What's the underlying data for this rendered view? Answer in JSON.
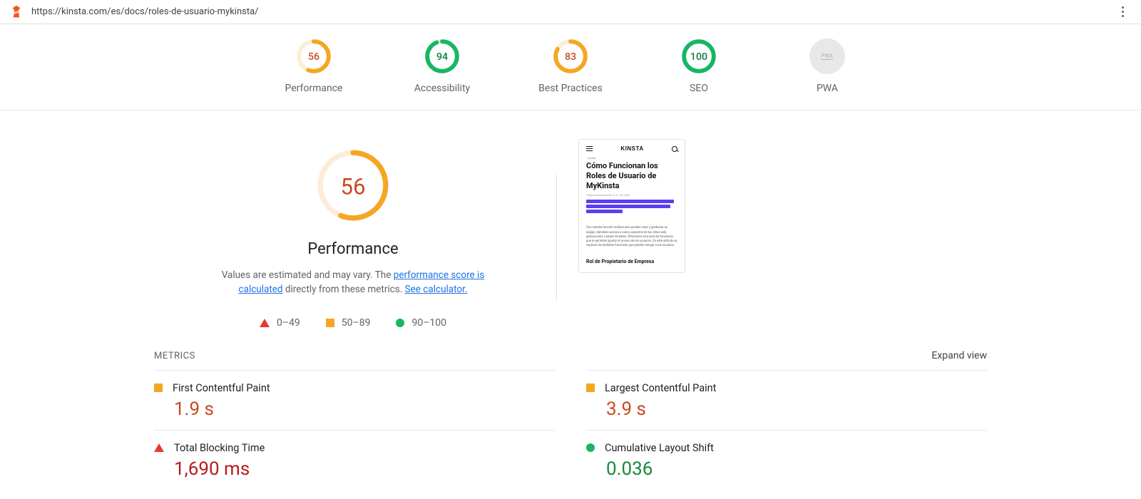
{
  "topbar": {
    "url": "https://kinsta.com/es/docs/roles-de-usuario-mykinsta/"
  },
  "colors": {
    "red": "#e53935",
    "orange": "#f5a623",
    "green": "#18b663",
    "grey": "#bdbdbd",
    "orangeText": "#c74a22",
    "greenText": "#0c7b3e"
  },
  "gauges": [
    {
      "label": "Performance",
      "score": 56,
      "tier": "orange"
    },
    {
      "label": "Accessibility",
      "score": 94,
      "tier": "green"
    },
    {
      "label": "Best Practices",
      "score": 83,
      "tier": "orange"
    },
    {
      "label": "SEO",
      "score": 100,
      "tier": "green"
    }
  ],
  "pwa_label": "PWA",
  "hero": {
    "score": 56,
    "tier": "orange",
    "title": "Performance",
    "desc_parts": {
      "a": "Values are estimated and may vary. The ",
      "link1": "performance score is calculated",
      "b": " directly from these metrics. ",
      "link2": "See calculator."
    },
    "legend": {
      "red": "0–49",
      "orange": "50–89",
      "green": "90–100"
    }
  },
  "preview": {
    "brand": "KINSTA",
    "breadcrumb": "‹ Ayuda",
    "headline": "Cómo Funcionan los Roles de Usuario de MyKinsta",
    "date": "Última actualización el 21.02.2023",
    "para": "Con nuestra función multiusuario puedes crear y gestionar un equipo, dándoles acceso a varios aspectos de tus sitios web, aplicaciones o bases de datos. Ofrecemos una serie de funciones que te permiten ajustar el acceso de los usuarios. En este artículo se explican las distintas funciones que puedes otorgar a tus usuarios.",
    "h2": "Rol de Propietario de Empresa"
  },
  "metrics_section": {
    "label": "METRICS",
    "expand": "Expand view"
  },
  "metrics": [
    {
      "name": "First Contentful Paint",
      "value": "1.9 s",
      "tier": "orange",
      "shape": "sq"
    },
    {
      "name": "Largest Contentful Paint",
      "value": "3.9 s",
      "tier": "orange",
      "shape": "sq"
    },
    {
      "name": "Total Blocking Time",
      "value": "1,690 ms",
      "tier": "red",
      "shape": "tri"
    },
    {
      "name": "Cumulative Layout Shift",
      "value": "0.036",
      "tier": "green",
      "shape": "cir"
    }
  ]
}
